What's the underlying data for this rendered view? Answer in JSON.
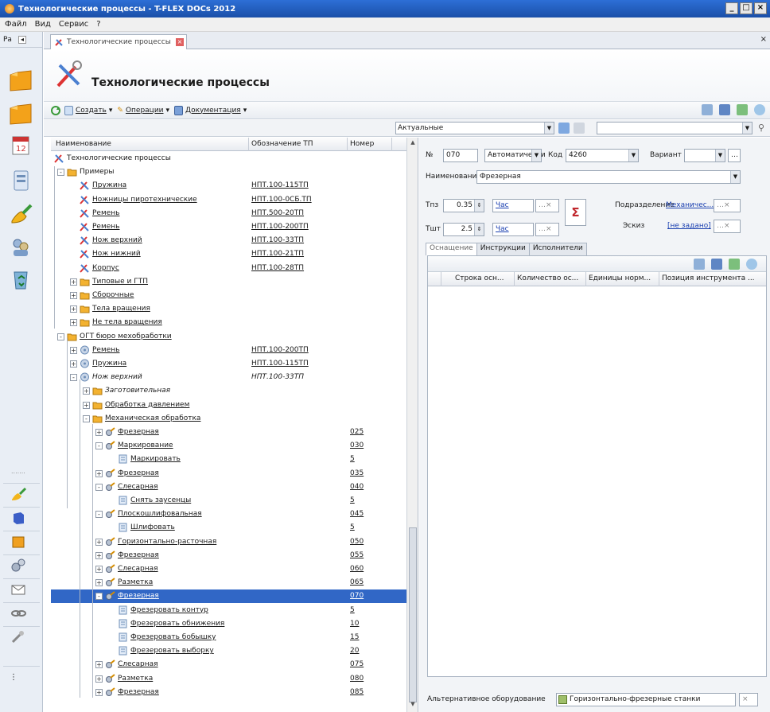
{
  "window": {
    "title": "Технологические процессы - T-FLEX DOCs 2012"
  },
  "menu": [
    "Файл",
    "Вид",
    "Сервис",
    "?"
  ],
  "left_panel": {
    "header": "Ра"
  },
  "doc_tab": {
    "label": "Технологические процессы"
  },
  "page_title": "Технологические процессы",
  "toolbar": {
    "create": "Создать",
    "operations": "Операции",
    "documentation": "Документация"
  },
  "filter": {
    "value": "Актуальные"
  },
  "tree_columns": {
    "name": "Наименование",
    "code": "Обозначение ТП",
    "number": "Номер"
  },
  "tree_rows": [
    {
      "name": "Технологические процессы",
      "code": "",
      "number": ""
    },
    {
      "name": "Примеры",
      "code": "",
      "number": ""
    },
    {
      "name": "Пружина",
      "code": "НПТ.100-115ТП",
      "number": ""
    },
    {
      "name": "Ножницы пиротехнические",
      "code": "НПТ.100-0СБ.ТП",
      "number": ""
    },
    {
      "name": "Ремень",
      "code": "НПТ.500-20ТП",
      "number": ""
    },
    {
      "name": "Ремень",
      "code": "НПТ.100-200ТП",
      "number": ""
    },
    {
      "name": "Нож верхний",
      "code": "НПТ.100-33ТП",
      "number": ""
    },
    {
      "name": "Нож нижний",
      "code": "НПТ.100-21ТП",
      "number": ""
    },
    {
      "name": "Корпус",
      "code": "НПТ.100-28ТП",
      "number": ""
    },
    {
      "name": "Типовые и ГТП",
      "code": "",
      "number": ""
    },
    {
      "name": "Сборочные",
      "code": "",
      "number": ""
    },
    {
      "name": "Тела вращения",
      "code": "",
      "number": ""
    },
    {
      "name": "Не тела вращения",
      "code": "",
      "number": ""
    },
    {
      "name": "ОГТ бюро мехобработки",
      "code": "",
      "number": ""
    },
    {
      "name": "Ремень",
      "code": "НПТ.100-200ТП",
      "number": ""
    },
    {
      "name": "Пружина",
      "code": "НПТ.100-115ТП",
      "number": ""
    },
    {
      "name": "Нож верхний",
      "code": "НПТ.100-33ТП",
      "number": ""
    },
    {
      "name": "Заготовительная",
      "code": "",
      "number": ""
    },
    {
      "name": "Обработка давлением",
      "code": "",
      "number": ""
    },
    {
      "name": "Механическая обработка",
      "code": "",
      "number": ""
    },
    {
      "name": "Фрезерная",
      "code": "",
      "number": "025"
    },
    {
      "name": "Маркирование",
      "code": "",
      "number": "030"
    },
    {
      "name": "Маркировать",
      "code": "",
      "number": "5"
    },
    {
      "name": "Фрезерная",
      "code": "",
      "number": "035"
    },
    {
      "name": "Слесарная",
      "code": "",
      "number": "040"
    },
    {
      "name": "Снять заусенцы",
      "code": "",
      "number": "5"
    },
    {
      "name": "Плоскошлифовальная",
      "code": "",
      "number": "045"
    },
    {
      "name": "Шлифовать",
      "code": "",
      "number": "5"
    },
    {
      "name": "Горизонтально-расточная",
      "code": "",
      "number": "050"
    },
    {
      "name": "Фрезерная",
      "code": "",
      "number": "055"
    },
    {
      "name": "Слесарная",
      "code": "",
      "number": "060"
    },
    {
      "name": "Разметка",
      "code": "",
      "number": "065"
    },
    {
      "name": "Фрезерная",
      "code": "",
      "number": "070"
    },
    {
      "name": "Фрезеровать контур",
      "code": "",
      "number": "5"
    },
    {
      "name": "Фрезеровать обнижения",
      "code": "",
      "number": "10"
    },
    {
      "name": "Фрезеровать бобышку",
      "code": "",
      "number": "15"
    },
    {
      "name": "Фрезеровать выборку",
      "code": "",
      "number": "20"
    },
    {
      "name": "Слесарная",
      "code": "",
      "number": "075"
    },
    {
      "name": "Разметка",
      "code": "",
      "number": "080"
    },
    {
      "name": "Фрезерная",
      "code": "",
      "number": "085"
    }
  ],
  "props": {
    "num_label": "№",
    "num_value": "070",
    "mode_value": "Автоматически",
    "code_label": "Код",
    "code_value": "4260",
    "variant_label": "Вариант",
    "name_label": "Наименование",
    "name_value": "Фрезерная",
    "tpz_label": "Тпз",
    "tpz_value": "0.35",
    "tpz_unit": "Час",
    "tsht_label": "Тшт",
    "tsht_value": "2.5",
    "tsht_unit": "Час",
    "dept_label": "Подразделение",
    "dept_value": "Механичес...",
    "sketch_label": "Эскиз",
    "sketch_value": "[не задано]",
    "sigma": "Σ"
  },
  "right_tabs": [
    "Оснащение",
    "Инструкции",
    "Исполнители"
  ],
  "grid_columns": [
    "Строка осн...",
    "Количество ос...",
    "Единицы норм...",
    "Позиция инструмента ..."
  ],
  "alt_equipment": {
    "label": "Альтернативное оборудование",
    "value": "Горизонтально-фрезерные станки"
  }
}
